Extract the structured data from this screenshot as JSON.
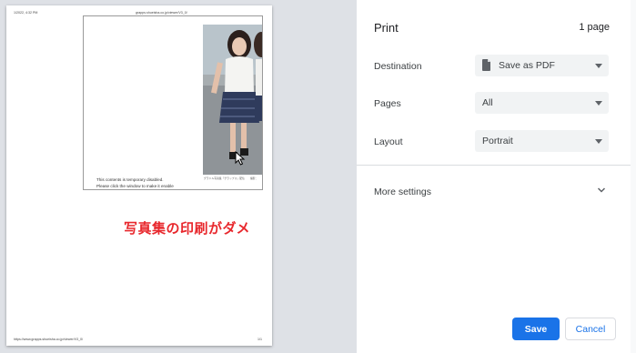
{
  "preview": {
    "header_left": "1/2022, 4:32 PM",
    "header_center": "grapps.shueisha.co.jp/viewer/V3_0/",
    "footer_left": "https://www.grapps.shueisha.co.jp/viewer/V3_0/",
    "footer_right": "1/1",
    "notice_line1": "This contents is temporary disabled.",
    "notice_line2": "Please click the window to make it enable",
    "caption_left": "グラドル写真集「グラップス」配信",
    "caption_right": "撮影：",
    "overlay_text": "写真集の印刷がダメ"
  },
  "panel": {
    "title": "Print",
    "page_count": "1 page",
    "destination_label": "Destination",
    "destination_value": "Save as PDF",
    "pages_label": "Pages",
    "pages_value": "All",
    "layout_label": "Layout",
    "layout_value": "Portrait",
    "more_settings_label": "More settings",
    "save_label": "Save",
    "cancel_label": "Cancel"
  },
  "colors": {
    "accent": "#1a73e8",
    "overlay_text": "#e8282d",
    "preview_bg": "#dee1e6"
  },
  "icons": {
    "destination": "pdf-file-icon",
    "select_caret": "caret-down-icon",
    "more_settings": "chevron-down-icon",
    "mouse": "cursor-arrow-icon"
  }
}
